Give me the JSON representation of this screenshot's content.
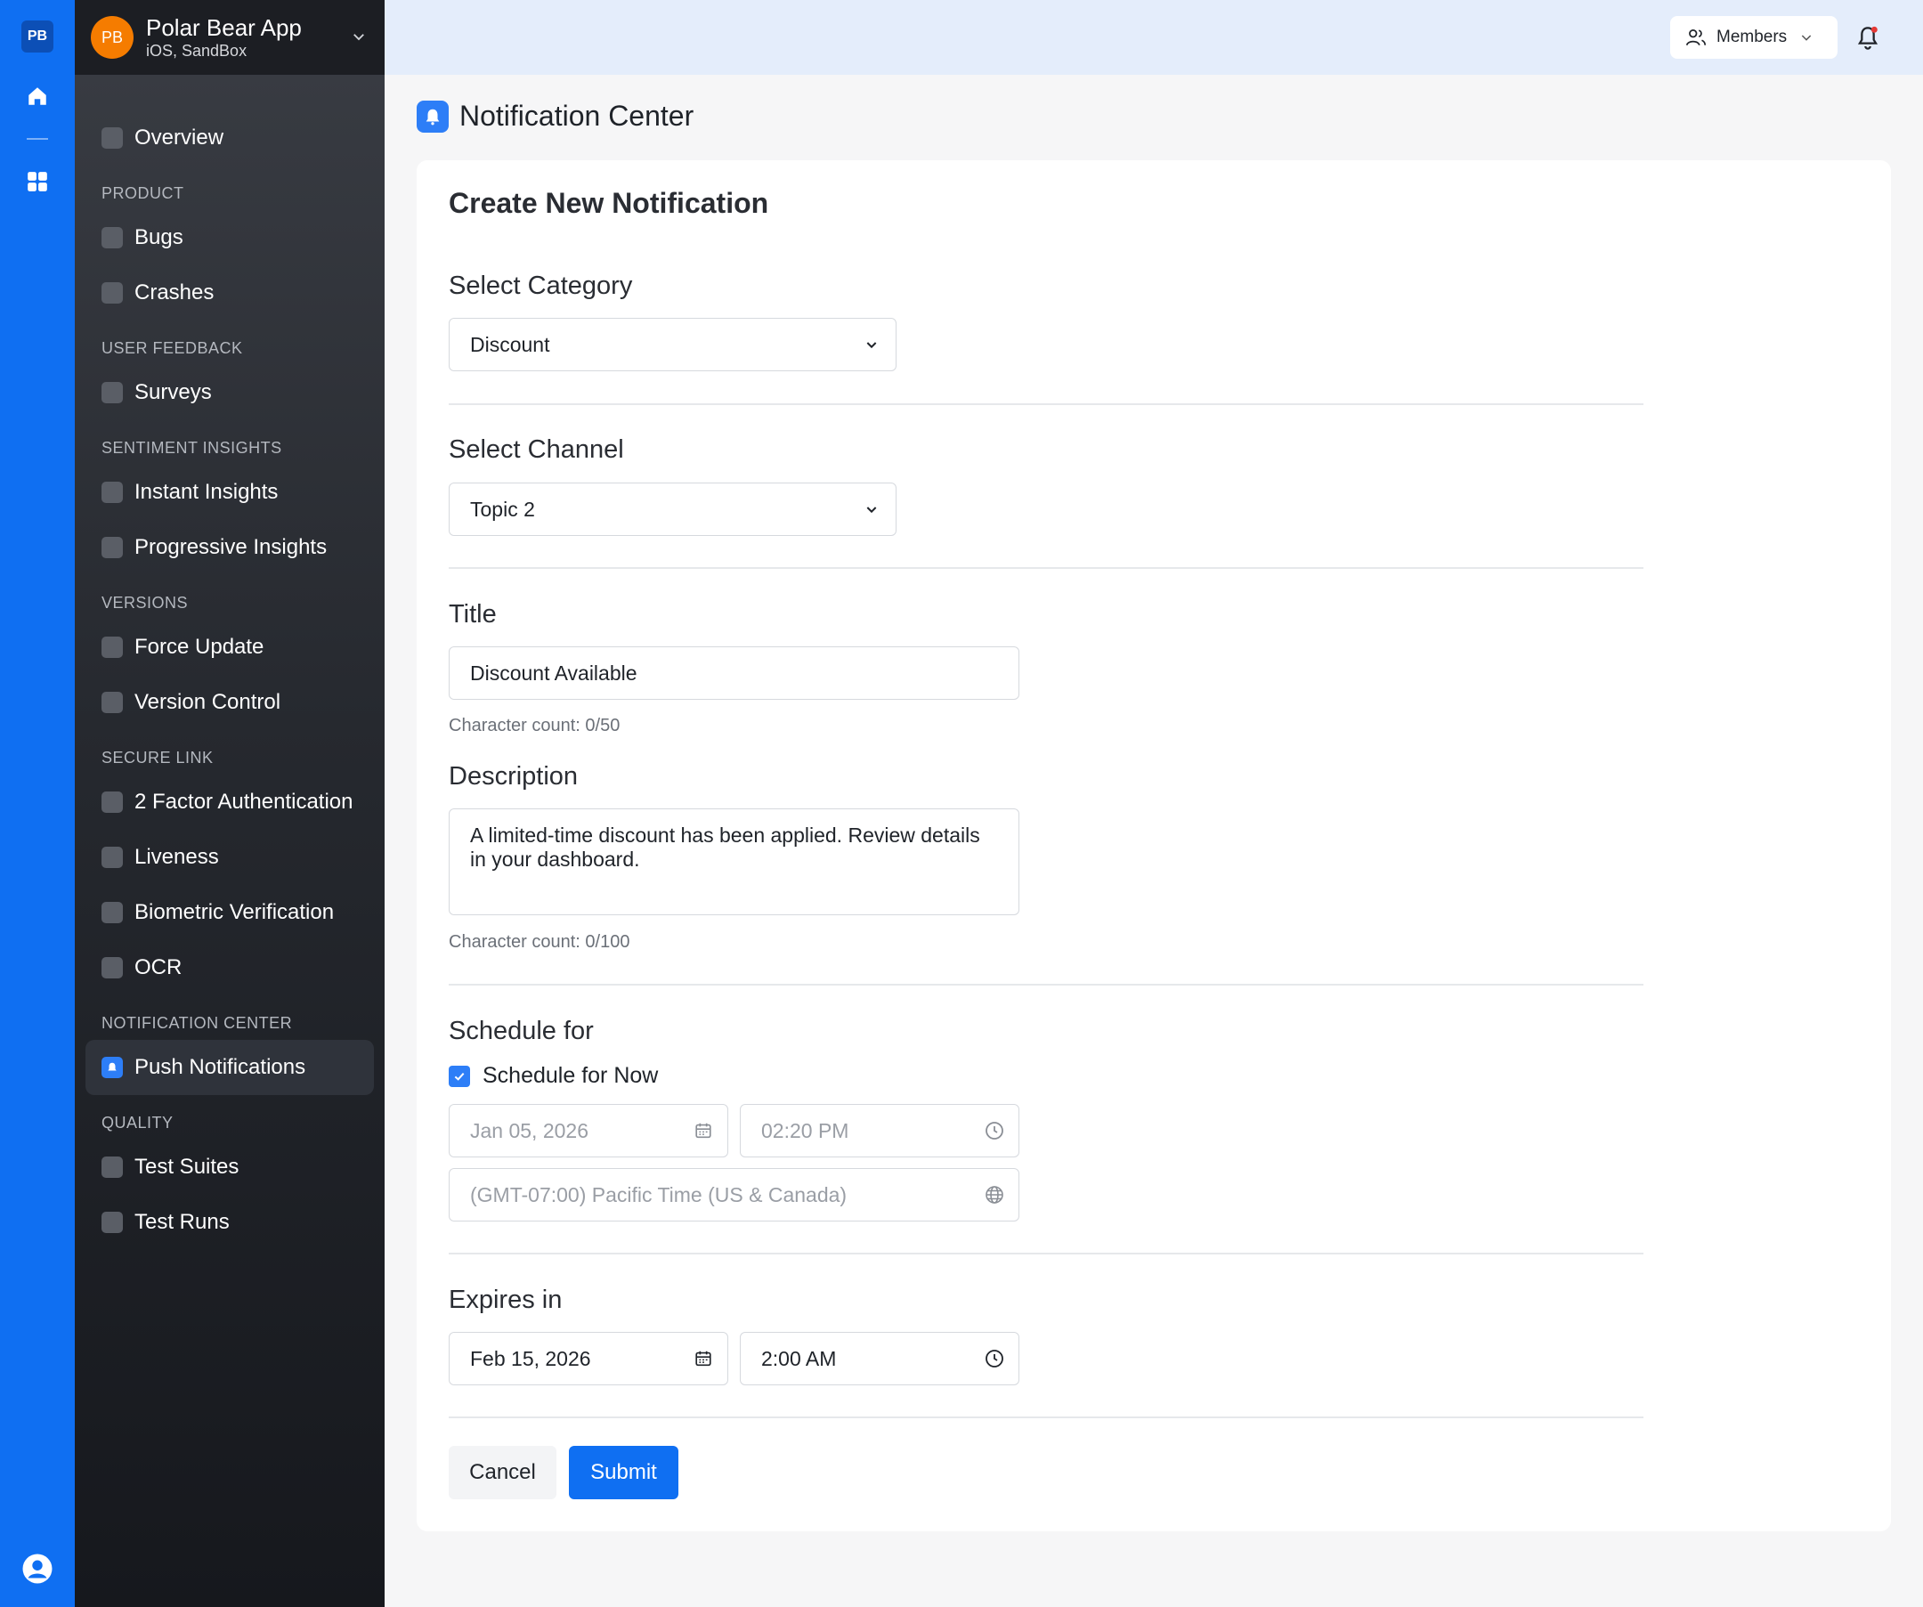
{
  "rail": {
    "badge": "PB"
  },
  "app": {
    "avatar": "PB",
    "name": "Polar Bear App",
    "subtitle": "iOS, SandBox"
  },
  "sidebar": {
    "overview": "Overview",
    "sections": [
      {
        "title": "PRODUCT",
        "items": [
          "Bugs",
          "Crashes"
        ]
      },
      {
        "title": "USER FEEDBACK",
        "items": [
          "Surveys"
        ]
      },
      {
        "title": "SENTIMENT INSIGHTS",
        "items": [
          "Instant Insights",
          "Progressive Insights"
        ]
      },
      {
        "title": "VERSIONS",
        "items": [
          "Force Update",
          "Version Control"
        ]
      },
      {
        "title": "SECURE LINK",
        "items": [
          "2 Factor Authentication",
          "Liveness",
          "Biometric Verification",
          "OCR"
        ]
      },
      {
        "title": "NOTIFICATION CENTER",
        "items": [
          "Push Notifications"
        ]
      },
      {
        "title": "QUALITY",
        "items": [
          "Test Suites",
          "Test Runs"
        ]
      }
    ],
    "active": "Push Notifications"
  },
  "topbar": {
    "members_label": "Members"
  },
  "page": {
    "title": "Notification Center"
  },
  "form": {
    "heading": "Create New Notification",
    "category_label": "Select Category",
    "category_value": "Discount",
    "channel_label": "Select Channel",
    "channel_value": "Topic 2",
    "title_label": "Title",
    "title_value": "Discount Available",
    "title_count": "Character count: 0/50",
    "description_label": "Description",
    "description_value": "A limited-time discount has been applied. Review details in your dashboard.",
    "description_count": "Character count: 0/100",
    "schedule_label": "Schedule for",
    "schedule_now_label": "Schedule for Now",
    "schedule_now_checked": true,
    "schedule_date": "Jan 05, 2026",
    "schedule_time": "02:20 PM",
    "schedule_timezone": "(GMT-07:00) Pacific Time (US & Canada)",
    "expires_label": "Expires in",
    "expires_date": "Feb 15, 2026",
    "expires_time": "2:00 AM",
    "cancel_label": "Cancel",
    "submit_label": "Submit"
  },
  "colors": {
    "accent": "#0f6ff2",
    "rail": "#0f6ff2",
    "avatar": "#f57c00",
    "notification_dot": "#e53935"
  }
}
